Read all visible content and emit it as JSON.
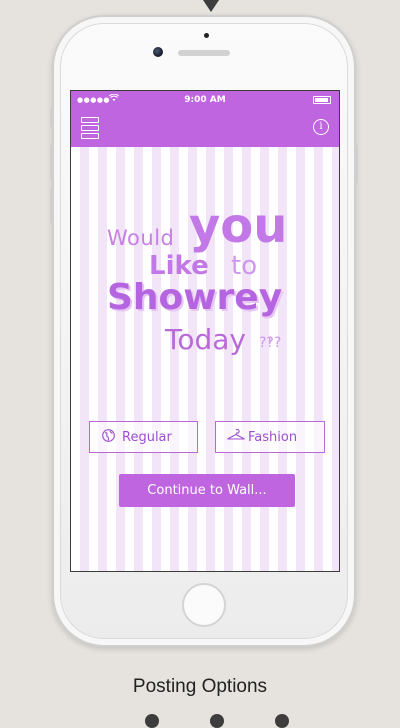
{
  "status_bar": {
    "signal": "●●●●●",
    "time": "9:00 AM"
  },
  "app_bar": {
    "menu_icon": "menu-icon",
    "info_icon": "info-icon",
    "info_glyph": "i"
  },
  "headline": {
    "word_would": "Would",
    "word_you": "you",
    "word_like": "Like",
    "word_to": "to",
    "word_showrey": "Showrey",
    "word_today": "Today",
    "word_question": "?‽?"
  },
  "options": [
    {
      "label": "Regular",
      "icon": "globe-icon",
      "glyph": "🌍"
    },
    {
      "label": "Fashion",
      "icon": "hanger-icon",
      "glyph": "⌂"
    }
  ],
  "continue_label": "Continue to Wall...",
  "caption": "Posting Options",
  "colors": {
    "accent": "#c065e0",
    "background": "#e6e2dd"
  }
}
